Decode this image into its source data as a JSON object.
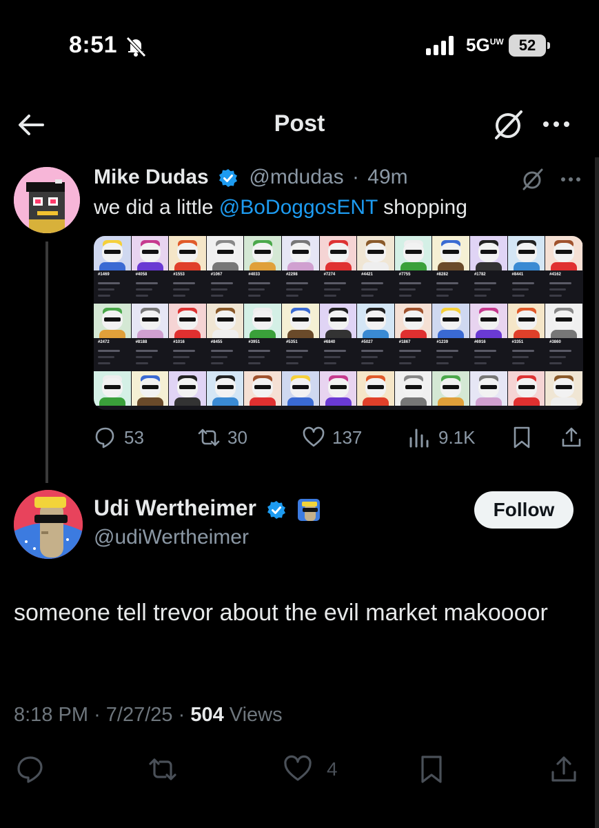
{
  "status_bar": {
    "time": "8:51",
    "network": "5G",
    "network_sup": "UW",
    "battery": "52"
  },
  "nav": {
    "title": "Post"
  },
  "quoted_post": {
    "author_name": "Mike Dudas",
    "handle": "@mdudas",
    "time": "49m",
    "text_prefix": "we did a little ",
    "mention": "@BoDoggosENT",
    "text_suffix": " shopping",
    "nft_ids_row1": [
      "#1469",
      "#4058",
      "#1553",
      "#1067",
      "#4033",
      "#2298",
      "#7274",
      "#4421",
      "#7755",
      "#8282",
      "#1782",
      "#8441",
      "#4162"
    ],
    "nft_ids_row2": [
      "#2472",
      "#8188",
      "#1016",
      "#8455",
      "#3951",
      "#5351",
      "#6840",
      "#5027",
      "#1867",
      "#1239",
      "#6916",
      "#3351",
      "#3860"
    ],
    "replies": "53",
    "reposts": "30",
    "likes": "137",
    "views": "9.1K"
  },
  "main_post": {
    "author_name": "Udi Wertheimer",
    "handle": "@udiWertheimer",
    "follow_label": "Follow",
    "text": "someone tell trevor about the evil market makoooor",
    "time": "8:18 PM",
    "date": "7/27/25",
    "views_count": "504",
    "views_label": "Views",
    "likes": "4"
  },
  "colors": {
    "accent": "#1d9bf0",
    "background": "#000000",
    "muted": "#8b98a5"
  }
}
